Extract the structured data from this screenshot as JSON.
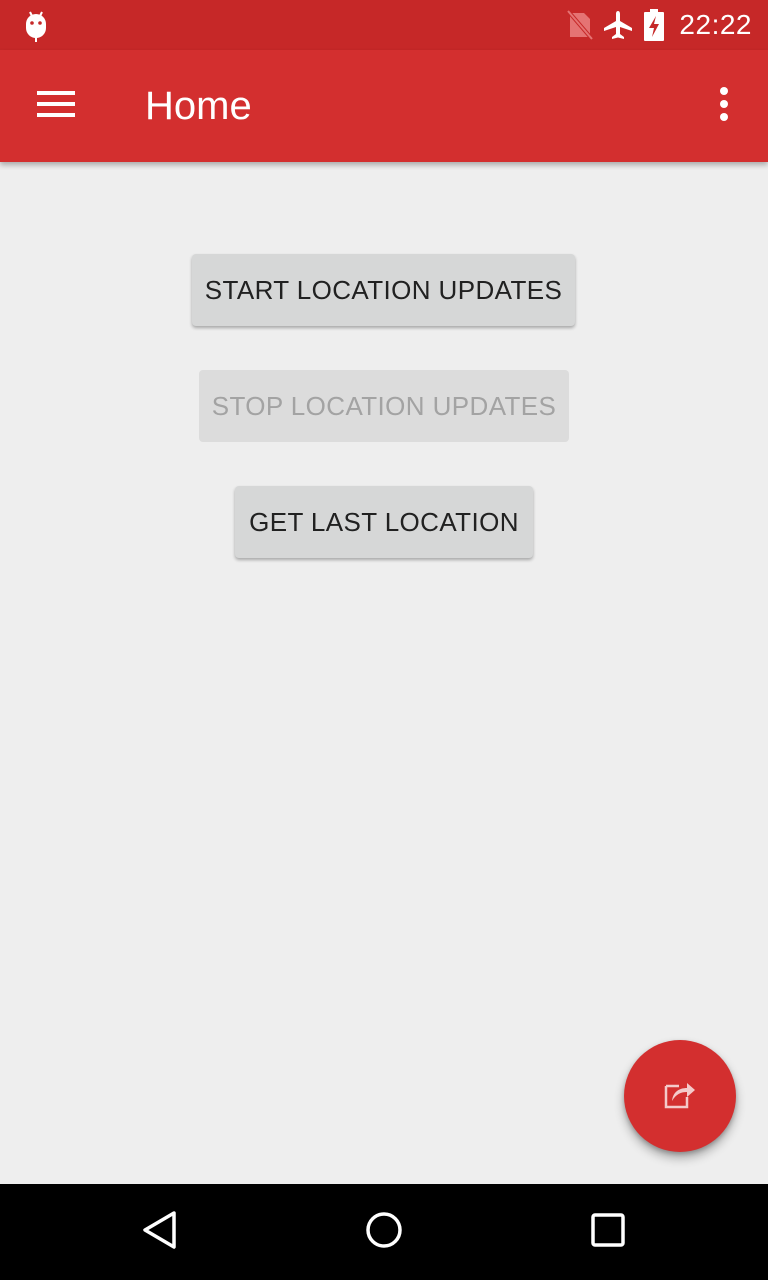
{
  "status_bar": {
    "time": "22:22",
    "icons": [
      "android-debug-icon",
      "no-sim-icon",
      "airplane-mode-icon",
      "battery-charging-icon"
    ],
    "color": "#c62828"
  },
  "app_bar": {
    "title": "Home",
    "menu_icon": "hamburger-menu-icon",
    "overflow_icon": "more-vert-icon",
    "color": "#d32f2f"
  },
  "buttons": {
    "start": {
      "label": "START LOCATION UPDATES",
      "enabled": true
    },
    "stop": {
      "label": "STOP LOCATION UPDATES",
      "enabled": false
    },
    "last": {
      "label": "GET LAST LOCATION",
      "enabled": true
    }
  },
  "fab": {
    "icon": "share-edit-icon",
    "color": "#d32f2f"
  },
  "nav_bar": {
    "icons": [
      "back-icon",
      "home-icon",
      "recents-icon"
    ]
  }
}
